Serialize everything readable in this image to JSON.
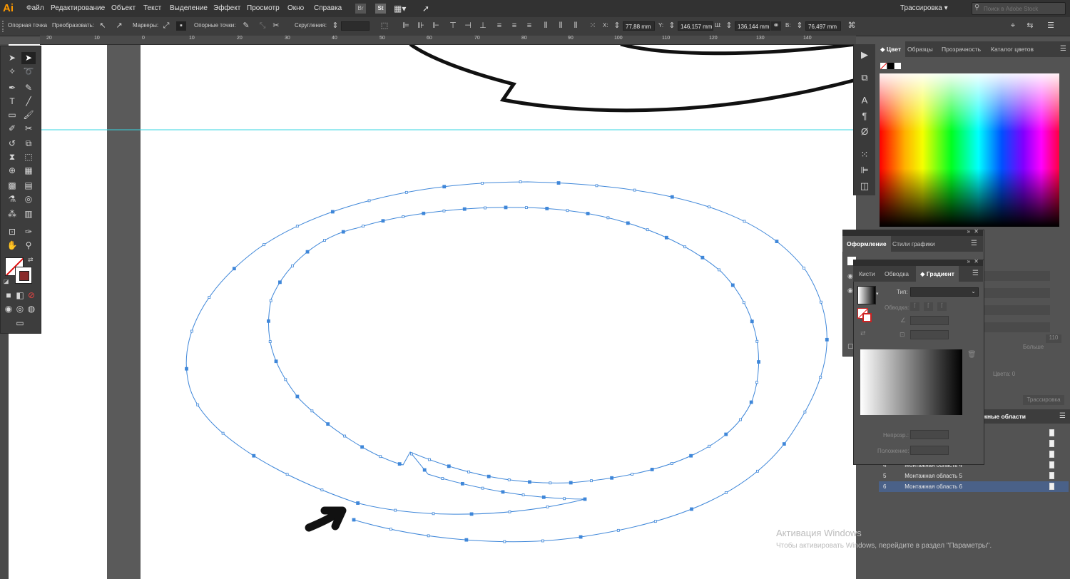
{
  "app": {
    "logo": "Ai",
    "workspace": "Трассировка",
    "stock_placeholder": "Поиск в Adobe Stock"
  },
  "menu": [
    "Файл",
    "Редактирование",
    "Объект",
    "Текст",
    "Выделение",
    "Эффект",
    "Просмотр",
    "Окно",
    "Справка"
  ],
  "menu_icons": {
    "bridge": "Br",
    "stock": "St"
  },
  "control_bar": {
    "anchor_label": "Опорная точка",
    "convert_label": "Преобразовать:",
    "handles_label": "Маркеры:",
    "anchors_label": "Опорные точки:",
    "corners_label": "Скругления:",
    "x_label": "X:",
    "x_value": "77,88 mm",
    "y_label": "Y:",
    "y_value": "146,157 mm",
    "w_label": "Ш:",
    "w_value": "136,144 mm",
    "h_label": "В:",
    "h_value": "76,497 mm"
  },
  "ruler_top": [
    "20",
    "10",
    "0",
    "10",
    "20",
    "30",
    "40",
    "50",
    "60",
    "70",
    "80",
    "90",
    "100",
    "110",
    "120",
    "130",
    "140"
  ],
  "right_panel": {
    "tabs": [
      "Цвет",
      "Образцы",
      "Прозрачность",
      "Каталог цветов"
    ]
  },
  "appearance_panel": {
    "tabs": [
      "Оформление",
      "Стили графики"
    ]
  },
  "gradient_panel": {
    "tabs": [
      "Кисти",
      "Обводка",
      "Градиент"
    ],
    "type_label": "Тип:",
    "stroke_label": "Обводка:",
    "opacity_label": "Непрозр.:",
    "location_label": "Положение:"
  },
  "ghost_text": {
    "more": "Больше",
    "value_110": "110",
    "colors": "Цвета: 0",
    "trace": "Трассировка"
  },
  "artboards": {
    "tab_label": "жные области",
    "rows": [
      {
        "num": "4",
        "name": "Монтажная область 4"
      },
      {
        "num": "5",
        "name": "Монтажная область 5"
      },
      {
        "num": "6",
        "name": "Монтажная область 6"
      }
    ]
  },
  "watermark": {
    "title": "Активация Windows",
    "subtitle": "Чтобы активировать Windows, перейдите в раздел \"Параметры\"."
  },
  "colors": {
    "selection": "#3f87d9",
    "guide": "#36d4e0",
    "brand": "#ff9a00"
  }
}
